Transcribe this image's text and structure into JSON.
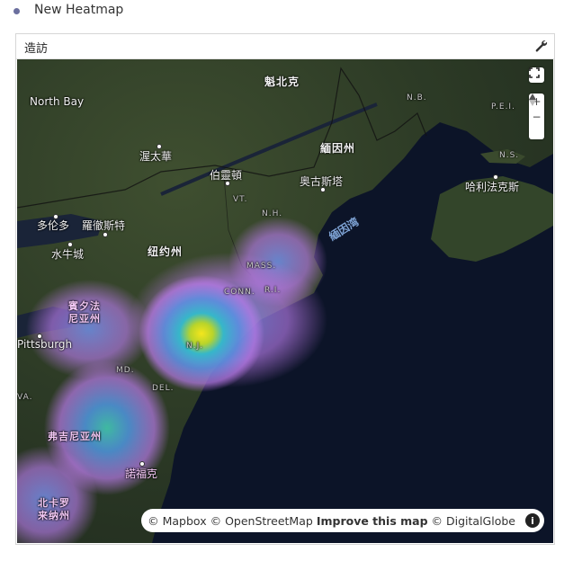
{
  "section": {
    "title": "New Heatmap"
  },
  "panel": {
    "title": "造訪",
    "settings_icon": "wrench-icon"
  },
  "map": {
    "labels": {
      "north_bay": "North Bay",
      "quebec": "魁北克",
      "nb": "N.B.",
      "pei": "P.E.I.",
      "ns": "N.S.",
      "ottawa": "渥太華",
      "maine": "緬因州",
      "burlington": "伯靈頓",
      "augusta": "奥古斯塔",
      "halifax": "哈利法克斯",
      "vt": "VT.",
      "nh": "N.H.",
      "toronto": "多伦多",
      "rochester": "羅徹斯特",
      "gulf_of_maine": "緬因湾",
      "buffalo": "水牛城",
      "new_york_state": "纽约州",
      "mass": "MASS.",
      "conn": "CONN.",
      "ri": "R.I.",
      "pennsylvania": "賓夕法\n尼亚州",
      "pittsburgh": "Pittsburgh",
      "nj": "N.J.",
      "md": "MD.",
      "del": "DEL.",
      "va": "VA.",
      "virginia": "弗吉尼亚州",
      "norfolk": "諾福克",
      "north_carolina": "北卡罗\n来纳州"
    },
    "controls": {
      "fullscreen": "fullscreen-icon",
      "zoom_in": "+",
      "zoom_out": "−",
      "compass": "compass-icon"
    },
    "attribution": {
      "mapbox": "© Mapbox",
      "osm": "© OpenStreetMap",
      "improve": "Improve this map",
      "digitalglobe": "© DigitalGlobe",
      "info": "i"
    },
    "heatmap": {
      "hotspots": [
        {
          "name": "New Jersey / New York",
          "intensity": 1.0
        },
        {
          "name": "Massachusetts",
          "intensity": 0.45
        },
        {
          "name": "Virginia",
          "intensity": 0.5
        },
        {
          "name": "North Carolina",
          "intensity": 0.35
        },
        {
          "name": "Pennsylvania",
          "intensity": 0.3
        }
      ],
      "colors": {
        "low": "#c77ef0",
        "mid": "#4aa3e8",
        "high": "#f3e21b"
      }
    }
  }
}
